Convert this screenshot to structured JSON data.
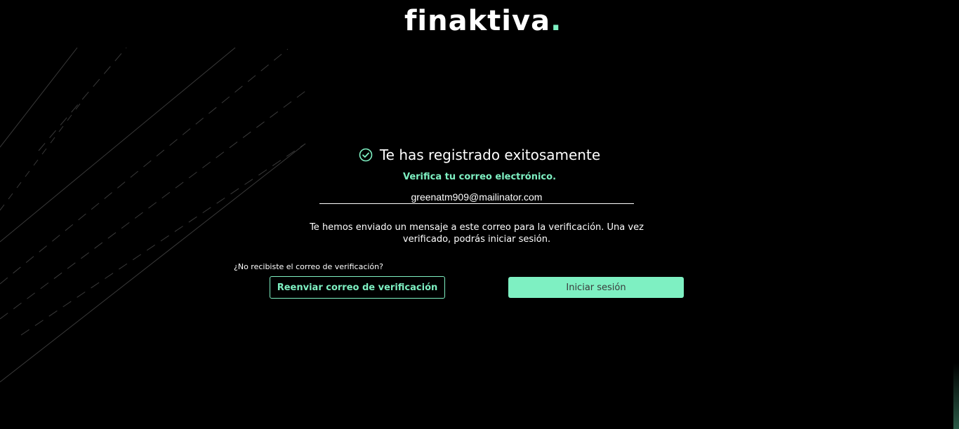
{
  "brand": {
    "name": "finaktiva",
    "dot": ".",
    "accent_color": "#7ef0c2"
  },
  "success": {
    "icon": "check-circle-icon",
    "title": "Te has registrado exitosamente"
  },
  "verification": {
    "label": "Verifica tu correo electrónico.",
    "email_value": "greenatm909@mailinator.com",
    "message": "Te hemos enviado un mensaje a este correo para la verificación. Una vez verificado, podrás iniciar sesión."
  },
  "actions": {
    "resend_question": "¿No recibiste el correo de verificación?",
    "resend_button": "Reenviar correo de verificación",
    "login_button": "Iniciar sesión"
  }
}
